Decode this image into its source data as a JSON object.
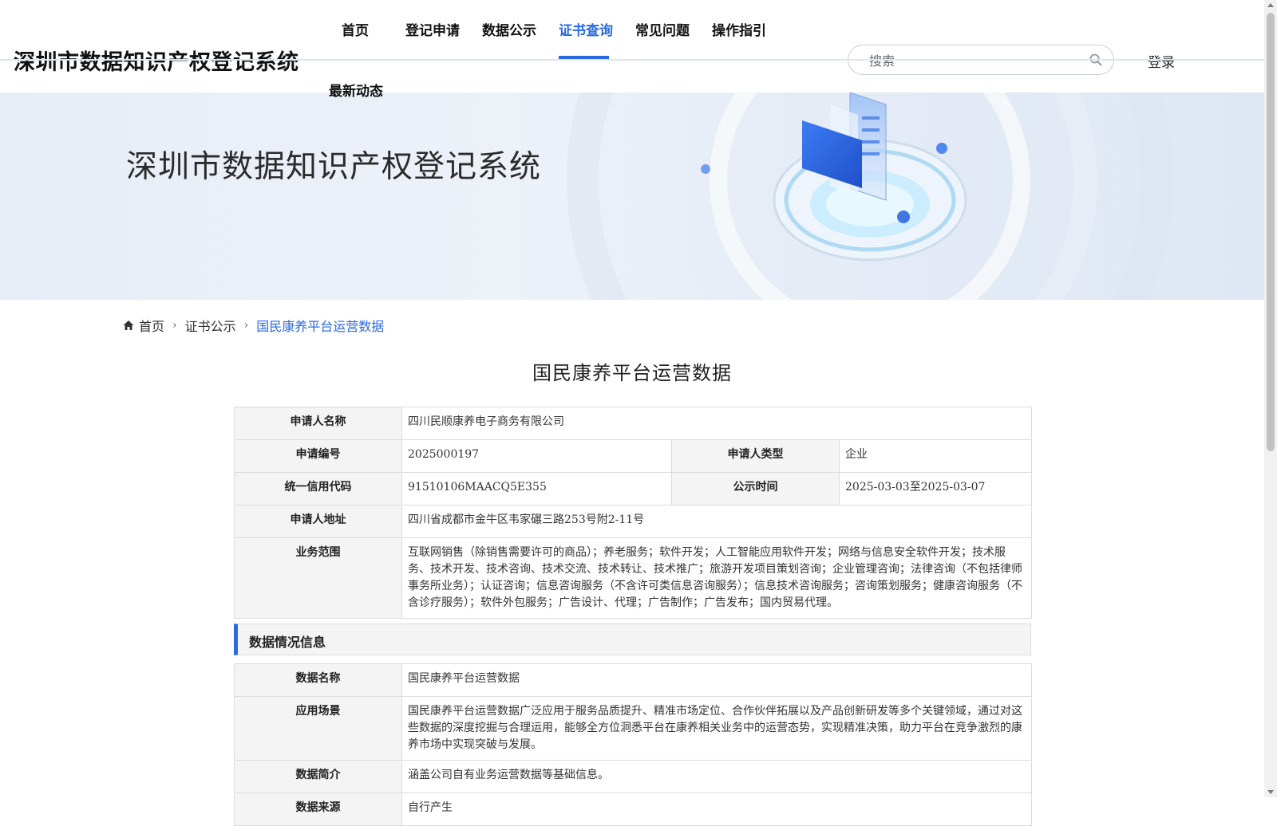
{
  "header": {
    "site_title": "深圳市数据知识产权登记系统",
    "nav": [
      {
        "label": "首页"
      },
      {
        "label": "登记申请"
      },
      {
        "label": "数据公示"
      },
      {
        "label": "证书查询"
      },
      {
        "label": "常见问题"
      },
      {
        "label": "操作指引"
      },
      {
        "label": "最新动态"
      }
    ],
    "active_nav": "证书查询",
    "search_placeholder": "搜索",
    "search_icon": "search-icon",
    "login_label": "登录"
  },
  "banner": {
    "title": "深圳市数据知识产权登记系统"
  },
  "breadcrumb": {
    "home_icon": "home-icon",
    "home": "首页",
    "section": "证书公示",
    "current": "国民康养平台运营数据"
  },
  "page_title": "国民康养平台运营数据",
  "applicant_table": {
    "applicant_name_label": "申请人名称",
    "applicant_name": "四川民顺康养电子商务有限公司",
    "application_no_label": "申请编号",
    "application_no": "2025000197",
    "applicant_type_label": "申请人类型",
    "applicant_type": "企业",
    "credit_code_label": "统一信用代码",
    "credit_code": "91510106MAACQ5E355",
    "publicity_time_label": "公示时间",
    "publicity_time": "2025-03-03至2025-03-07",
    "address_label": "申请人地址",
    "address": "四川省成都市金牛区韦家碾三路253号附2-11号",
    "business_scope_label": "业务范围",
    "business_scope": "互联网销售（除销售需要许可的商品）；养老服务；软件开发；人工智能应用软件开发；网络与信息安全软件开发；技术服务、技术开发、技术咨询、技术交流、技术转让、技术推广；旅游开发项目策划咨询；企业管理咨询；法律咨询（不包括律师事务所业务）；认证咨询；信息咨询服务（不含许可类信息咨询服务）；信息技术咨询服务；咨询策划服务；健康咨询服务（不含诊疗服务）；软件外包服务；广告设计、代理；广告制作；广告发布；国内贸易代理。"
  },
  "data_section": {
    "heading": "数据情况信息",
    "data_name_label": "数据名称",
    "data_name": "国民康养平台运营数据",
    "scenario_label": "应用场景",
    "scenario": "国民康养平台运营数据广泛应用于服务品质提升、精准市场定位、合作伙伴拓展以及产品创新研发等多个关键领域，通过对这些数据的深度挖掘与合理运用，能够全方位洞悉平台在康养相关业务中的运营态势，实现精准决策，助力平台在竞争激烈的康养市场中实现突破与发展。",
    "summary_label": "数据简介",
    "summary": "涵盖公司自有业务运营数据等基础信息。",
    "source_label": "数据来源",
    "source": "自行产生"
  },
  "colors": {
    "accent": "#2a6ae0",
    "label_bg": "#f4f4f4",
    "border": "#dcdcdc"
  }
}
